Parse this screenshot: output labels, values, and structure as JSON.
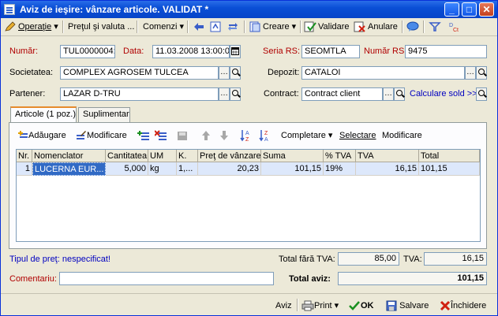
{
  "window": {
    "title": "Aviz de ieşire: vânzare articole. VALIDAT *"
  },
  "toolbar": {
    "operatie": "Operaţie",
    "pret": "Preţul şi valuta ...",
    "comenzi": "Comenzi",
    "creare": "Creare",
    "validare": "Validare",
    "anulare": "Anulare"
  },
  "form": {
    "numar_label": "Număr:",
    "numar_value": "TUL0000004:",
    "data_label": "Data:",
    "data_value": "11.03.2008 13:00:0",
    "seria_label": "Seria RS:",
    "seria_value": "SEOMTLA",
    "numar_rs_label": "Număr RS:",
    "numar_rs_value": "9475",
    "societatea_label": "Societatea:",
    "societatea_value": "COMPLEX AGROSEM TULCEA",
    "depozit_label": "Depozit:",
    "depozit_value": "CATALOI",
    "partener_label": "Partener:",
    "partener_value": "LAZAR D-TRU",
    "contract_label": "Contract:",
    "contract_value": "Contract client",
    "calculare": "Calculare sold >>"
  },
  "tabs": [
    {
      "label": "Articole (1 poz.)"
    },
    {
      "label": "Suplimentar"
    }
  ],
  "items_toolbar": {
    "adaugare": "Adăugare",
    "modificare": "Modificare",
    "completare": "Completare",
    "selectare": "Selectare",
    "modificare2": "Modificare"
  },
  "table": {
    "headers": [
      "Nr.",
      "Nomenclator",
      "Cantitatea",
      "UM",
      "K.",
      "Preţ de vânzare",
      "Suma",
      "% TVA",
      "TVA",
      "Total"
    ],
    "rows": [
      [
        "1",
        "LUCERNA EUR...",
        "5,000",
        "kg",
        "1,...",
        "20,23",
        "101,15",
        "19%",
        "16,15",
        "101,15"
      ]
    ]
  },
  "footer": {
    "tip_pret": "Tipul de preţ: nespecificat!",
    "total_fara_label": "Total fără TVA:",
    "total_fara_value": "85,00",
    "tva_label": "TVA:",
    "tva_value": "16,15",
    "comentariu_label": "Comentariu:",
    "comentariu_value": "",
    "total_label": "Total aviz:",
    "total_value": "101,15"
  },
  "statusbar": {
    "aviz": "Aviz",
    "print": "Print",
    "ok": "OK",
    "salvare": "Salvare",
    "inchidere": "Închidere"
  },
  "colors": {
    "titlebar": "#0a4fd6",
    "label_red": "#b00000",
    "link_blue": "#0000c0",
    "row_select": "#316ac5"
  }
}
